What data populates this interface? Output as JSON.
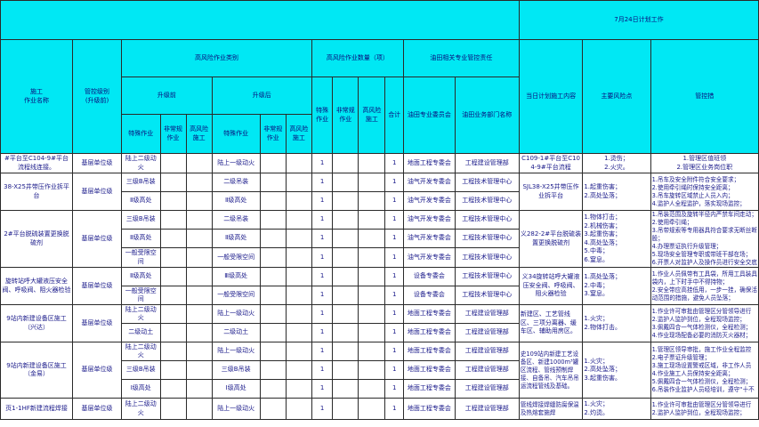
{
  "sheet": {
    "title": "7月24日计划工作",
    "headers": {
      "name": "施工\n作业名称",
      "level": "管控级别\n(升级前)",
      "types": "高风险作业类别",
      "before": "升级前",
      "after": "升级后",
      "special": "特殊作业",
      "nonroutine": "非常规作业",
      "hr": "高风险施工",
      "count": "高风险作业数量（项）",
      "total": "合计",
      "resp": "油田相关专业管控责任",
      "dept": "油田专业委员会",
      "bizdept": "油田业务部门名称",
      "content": "当日计划施工内容",
      "risk": "主要风险点",
      "measure": "管控措"
    },
    "rows": [
      {
        "name": "#平台至C104-9#平台流程线连接。",
        "level": "基层单位级",
        "b": "陆上二级动火",
        "a": "陆上一级动火",
        "c1": "1",
        "tot": "1",
        "dept": "地面工程专委会",
        "biz": "工程建设管理部",
        "content": "C109-1#平台至C104-9#平台流程",
        "risk": "1.烫伤；\n2.火灾。",
        "measure": "1.管理区值班领\n2.管理区业务岗位职"
      },
      {
        "name": "38-X25井带压作业拆平台",
        "level": "基层单位级",
        "b": "三级B吊装",
        "a": "二级吊装",
        "c1": "1",
        "tot": "1",
        "dept": "油气开发专委会",
        "biz": "工程技术管理中心"
      },
      {
        "b": "Ⅱ级高处",
        "a": "Ⅱ级高处",
        "c1": "1",
        "tot": "1",
        "dept": "油气开发专委会",
        "biz": "工程技术管理中心"
      },
      {
        "name": "2#平台脱硫装置更换脱硫剂",
        "level": "基层单位级",
        "b": "三级B吊装",
        "a": "二级吊装",
        "c1": "1",
        "tot": "1",
        "dept": "油气开发专委会",
        "biz": "工程技术管理中心"
      },
      {
        "b": "Ⅱ级高处",
        "a": "Ⅱ级高处",
        "c1": "1",
        "tot": "1",
        "dept": "油气开发专委会",
        "biz": "工程技术管理中心"
      },
      {
        "b": "一般受限空间",
        "a": "一般受限空间",
        "c1": "1",
        "tot": "1",
        "dept": "油气开发专委会",
        "biz": "工程技术管理中心"
      },
      {
        "name": "旋转站呼大罐液压安全阀、呼吸阀、阻火器检验",
        "level": "基层单位级",
        "b": "Ⅱ级高处",
        "a": "Ⅲ级高处",
        "c1": "1",
        "tot": "1",
        "dept": "设备专委会",
        "biz": "工程技术管理中心"
      },
      {
        "b": "一般受限空间",
        "a": "一般受限空间",
        "c1": "1",
        "tot": "1",
        "dept": "设备专委会",
        "biz": "工程技术管理中心"
      },
      {
        "name": "9站内新建设备区施工（兴达）",
        "level": "基层单位级",
        "b": "陆上二级动火",
        "a": "陆上一级动火",
        "c1": "1",
        "tot": "1",
        "dept": "地面工程专委会",
        "biz": "工程建设管理部",
        "content": "新建区、工艺管线区、三项分离器、缓车区、辅助用房区。",
        "risk": "1.火灾；\n2.物体打击。"
      },
      {
        "b": "二级动土",
        "a": "二级动土",
        "c1": "1",
        "tot": "1",
        "dept": "地面工程专委会",
        "biz": "工程建设管理部"
      },
      {
        "name": "9站内新建设备区施工（金易）",
        "level": "基层单位级",
        "b": "陆上二级动火",
        "a": "陆上一级动火",
        "c1": "1",
        "tot": "1",
        "dept": "地面工程专委会",
        "biz": "工程建设管理部",
        "content": "史109站内新建工艺设备区、新建1000m³罐区流程、管线预制焊接、自备吊、汽车吊吊运流程管线及基础。",
        "risk": "1.火灾；\n2.高处坠落；\n3.起重伤害。"
      },
      {
        "b": "三级B吊装",
        "a": "三级B吊装",
        "c1": "1",
        "tot": "1",
        "dept": "地面工程专委会",
        "biz": "工程建设管理部"
      },
      {
        "b": "Ⅰ级高处",
        "a": "Ⅰ级高处",
        "c1": "1",
        "tot": "1",
        "dept": "地面工程专委会",
        "biz": "工程建设管理部"
      },
      {
        "name": "页1-1HF新建流程焊接",
        "level": "基层单位级",
        "b": "陆上二级动火",
        "a": "陆上一级动火",
        "c1": "1",
        "tot": "1",
        "dept": "地面工程专委会",
        "biz": "工程建设管理部",
        "content": "管线焊接焊缝防腐保温及热熔套施焊",
        "risk": "1.火灾；\n2.灼烫。"
      }
    ],
    "merged": {
      "r2_content": "SJL38-X25井带压作业拆平台",
      "r2_risk": "1.起重伤害；\n2.高处坠落；",
      "r2_measure": "1.吊车及安全附件符合安全要求；\n2.使用牵引绳时保持安全距离；\n3.吊车旋转区域禁止人员入内；\n4.监护人全程监护，落实现场监控；",
      "r3_content": "义282-2#平台脱硫装置更换脱硫剂",
      "r3_risk": "1.物体打击；\n2.机械伤害；\n3.起重伤害；\n4.高处坠落；\n5.中毒；\n6.窒息。",
      "r3_measure": "1.吊装范围及旋转半径内严禁车间走动；\n2.使用牵引绳；\n3.吊带规索等专用器具符合要求无断丝断股；\n4.办理票证执行升级管理；\n5.现场安全管理专职或带班干部在场；\n6.开票人对监护人及操作员进行安全交底",
      "r4_content": "义34旋转站呼大罐液压安全阀、呼吸阀、阻火器检验",
      "r4_risk": "1.高处坠落；\n2.中毒；\n3.窒息。",
      "r4_measure": "1.作业人员佩带有工具袋，所用工具装具袋内，上下时手中不得持物；\n2.安全带应高挂低用，一步一挂，确保活动范围的措施，避免人员坠落；",
      "r5_measure": "1.作业许可审批由管理区分管领导进行\n2.监护人监护到位，全程现场监控；\n3.佩戴四合一气体检测仪，全程检测；\n4.作业现场配备必要的消防灭火器材；",
      "r6_measure": "1.管理区领导审批，施工作业全程监控\n2.电子票证升级管理；\n3.施工现场设置警戒区域，非工作人员\n4.作业施工人员保持安全距离；\n5.佩戴四合一气体检测仪，全程检测；\n6.吊装作业监护人员经培训，遵守“十不",
      "r7_measure": "1.作业许可审批由管理区分管领导进行\n2.监护人监护到位，全程现场监控；"
    }
  }
}
